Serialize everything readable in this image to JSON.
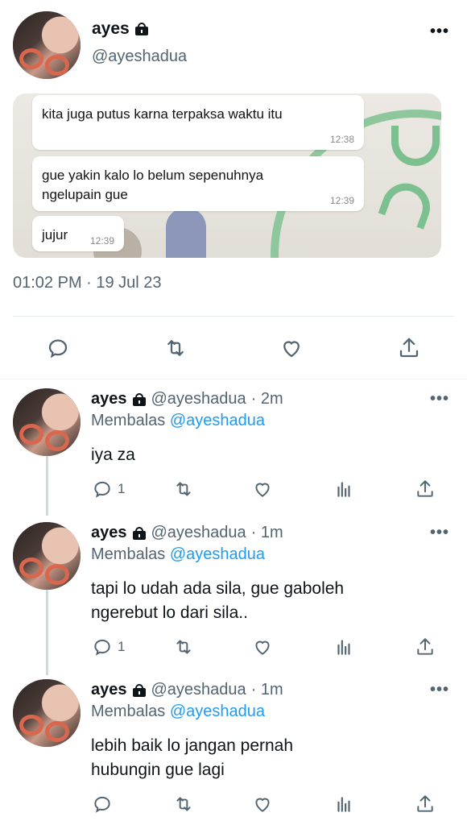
{
  "main_tweet": {
    "display_name": "ayes",
    "handle": "@ayeshadua",
    "more_icon": "more-horizontal-icon",
    "media": {
      "messages": [
        {
          "text": "kita juga putus karna terpaksa waktu itu",
          "time": "12:38"
        },
        {
          "text": "gue yakin kalo lo belum sepenuhnya ngelupain gue",
          "time": "12:39"
        },
        {
          "text": "jujur",
          "time": "12:39"
        }
      ]
    },
    "timestamp": "01:02 PM · 19 Jul 23",
    "actions": [
      "reply-icon",
      "retweet-icon",
      "like-icon",
      "share-icon"
    ]
  },
  "replies": [
    {
      "display_name": "ayes",
      "handle": "@ayeshadua",
      "time": "· 2m",
      "replying_prefix": "Membalas",
      "replying_to": "@ayeshadua",
      "text": "iya za",
      "reply_count": "1"
    },
    {
      "display_name": "ayes",
      "handle": "@ayeshadua",
      "time": "· 1m",
      "replying_prefix": "Membalas",
      "replying_to": "@ayeshadua",
      "text": "tapi lo udah ada sila, gue gaboleh ngerebut lo dari sila..",
      "reply_count": "1"
    },
    {
      "display_name": "ayes",
      "handle": "@ayeshadua",
      "time": "· 1m",
      "replying_prefix": "Membalas",
      "replying_to": "@ayeshadua",
      "text": "lebih baik lo jangan pernah hubungin gue lagi",
      "reply_count": ""
    }
  ],
  "colors": {
    "text_primary": "#0f1419",
    "text_secondary": "#536471",
    "link": "#1d9bf0",
    "divider": "#eff3f4"
  }
}
